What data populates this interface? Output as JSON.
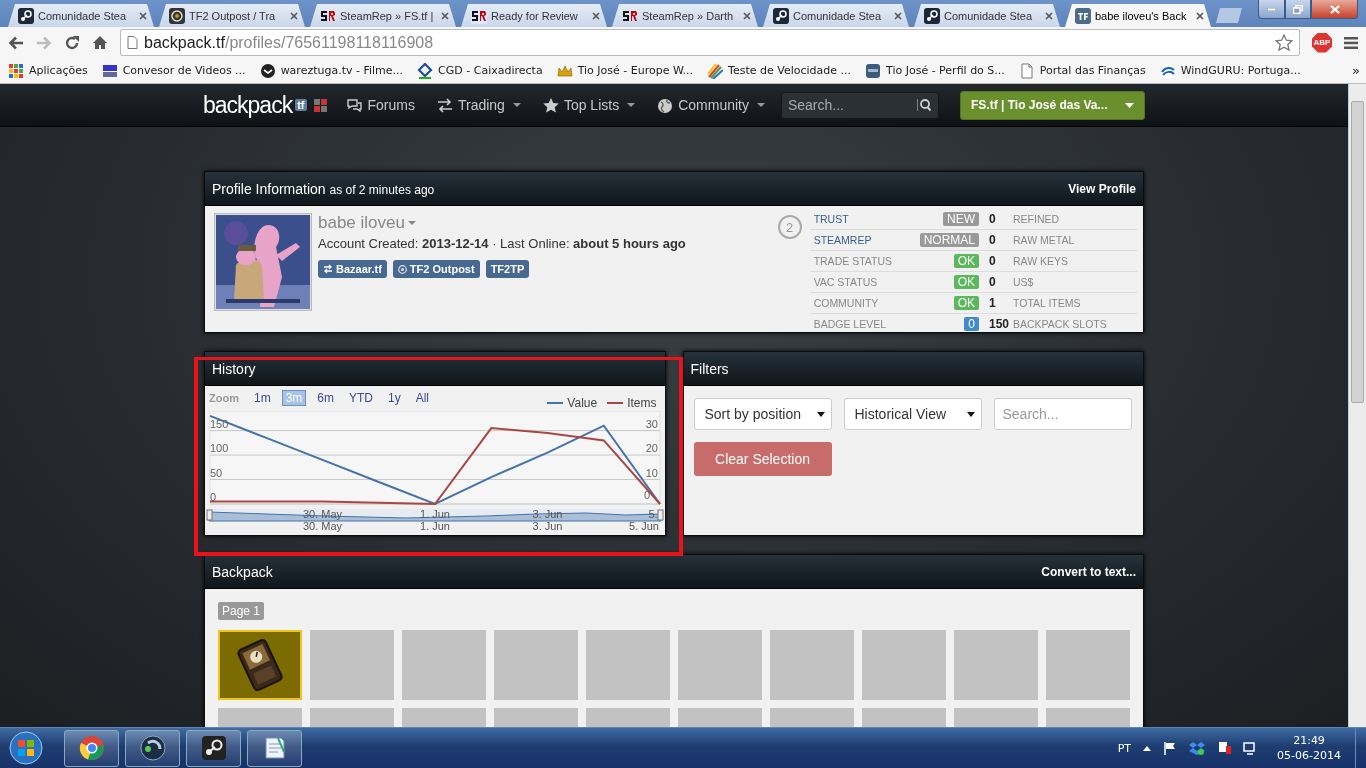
{
  "browser": {
    "tabs": [
      {
        "kind": "steam",
        "title": "Comunidade Stea",
        "selected": false
      },
      {
        "kind": "outpost",
        "title": "TF2 Outpost / Tra",
        "selected": false
      },
      {
        "kind": "sr",
        "title": "SteamRep » FS.tf |",
        "selected": false
      },
      {
        "kind": "sr-framed",
        "title": "Ready for Review",
        "selected": false
      },
      {
        "kind": "sr",
        "title": "SteamRep » Darth",
        "selected": false
      },
      {
        "kind": "steam",
        "title": "Comunidade Stea",
        "selected": false
      },
      {
        "kind": "steam",
        "title": "Comunidade Stea",
        "selected": false
      },
      {
        "kind": "tf",
        "title": "babe iloveu's Back",
        "selected": true
      }
    ],
    "address": {
      "domain": "backpack.tf",
      "path": "/profiles/76561198118116908"
    },
    "extension": "ABP",
    "bookmarks": [
      {
        "kind": "apps",
        "label": "Aplicações"
      },
      {
        "kind": "video",
        "label": "Convesor de Videos ..."
      },
      {
        "kind": "dark",
        "label": "wareztuga.tv - Filme..."
      },
      {
        "kind": "bank",
        "label": "CGD - Caixadirecta"
      },
      {
        "kind": "crown",
        "label": "Tio José - Europe W..."
      },
      {
        "kind": "rainbow",
        "label": "Teste de Velocidade ..."
      },
      {
        "kind": "square",
        "label": "Tio José - Perfil do S..."
      },
      {
        "kind": "page",
        "label": "Portal das Finanças"
      },
      {
        "kind": "wave",
        "label": "WindGURU: Portuga..."
      }
    ],
    "more": "»"
  },
  "nav": {
    "logo": "backpack",
    "logo_badge": "tf",
    "links": [
      {
        "kind": "forums",
        "label": "Forums",
        "dropdown": false
      },
      {
        "kind": "trading",
        "label": "Trading",
        "dropdown": true
      },
      {
        "kind": "star",
        "label": "Top Lists",
        "dropdown": true
      },
      {
        "kind": "globe",
        "label": "Community",
        "dropdown": true
      }
    ],
    "search": {
      "placeholder": "Search..."
    },
    "user": "FS.tf | Tio José das Va..."
  },
  "profile": {
    "title": "Profile Information",
    "subtitle": "as of 2 minutes ago",
    "action": "View Profile",
    "name": "babe iloveu",
    "info": "Account Created: **2013-12-14** · Last Online: **about 5 hours ago**",
    "buttons": [
      {
        "kind": "bazaar",
        "label": "Bazaar.tf"
      },
      {
        "kind": "outpost",
        "label": "TF2 Outpost"
      },
      {
        "kind": "plain",
        "label": "TF2TP"
      }
    ],
    "count": "2",
    "status": [
      {
        "label": "TRUST",
        "link": true,
        "badge": "NEW",
        "color": "#999999"
      },
      {
        "label": "STEAMREP",
        "link": true,
        "badge": "NORMAL",
        "color": "#999999"
      },
      {
        "label": "TRADE STATUS",
        "link": false,
        "badge": "OK",
        "color": "#5cb85c"
      },
      {
        "label": "VAC STATUS",
        "link": false,
        "badge": "OK",
        "color": "#5cb85c"
      },
      {
        "label": "COMMUNITY",
        "link": false,
        "badge": "OK",
        "color": "#5cb85c"
      },
      {
        "label": "BADGE LEVEL",
        "link": false,
        "badge": "0",
        "color": "#428bca"
      }
    ],
    "totals": [
      {
        "value": "0",
        "label": "REFINED"
      },
      {
        "value": "0",
        "label": "RAW METAL"
      },
      {
        "value": "0",
        "label": "RAW KEYS"
      },
      {
        "value": "0",
        "label": "US$"
      },
      {
        "value": "1",
        "label": "TOTAL ITEMS"
      },
      {
        "value": "150",
        "label": "BACKPACK SLOTS"
      }
    ]
  },
  "history": {
    "title": "History",
    "zoom_label": "Zoom",
    "ranges": [
      {
        "label": "1m",
        "selected": false
      },
      {
        "label": "3m",
        "selected": true
      },
      {
        "label": "6m",
        "selected": false
      },
      {
        "label": "YTD",
        "selected": false
      },
      {
        "label": "1y",
        "selected": false
      },
      {
        "label": "All",
        "selected": false
      }
    ],
    "chart_data": {
      "type": "line",
      "categories": [
        null,
        null,
        "30. May",
        null,
        "1. Jun",
        null,
        "3. Jun",
        null,
        "5."
      ],
      "series": [
        {
          "name": "Value",
          "color": "#4572a7",
          "values": [
            180,
            135,
            90,
            45,
            0,
            55,
            105,
            160,
            0
          ]
        },
        {
          "name": "Items",
          "color": "#aa4643",
          "values": [
            1,
            1,
            1,
            0.5,
            0,
            31,
            29,
            26,
            0
          ],
          "axis": "y2"
        }
      ],
      "ylim": [
        0,
        190
      ],
      "y2lim": [
        0,
        38
      ],
      "grid": true,
      "legend": "top right",
      "yticks": [
        0,
        50,
        100,
        150
      ],
      "y2ticks": [
        0,
        10,
        20,
        30
      ]
    },
    "navigator_labels": [
      "30. May",
      "1. Jun",
      "3. Jun",
      "5. Jun"
    ]
  },
  "filters": {
    "title": "Filters",
    "selects": [
      {
        "value": "Sort by position"
      },
      {
        "value": "Historical View"
      }
    ],
    "search": {
      "placeholder": "Search..."
    },
    "button": "Clear Selection"
  },
  "backpack": {
    "title": "Backpack",
    "action": "Convert to text...",
    "page": "Page 1",
    "slots": [
      {
        "filled": true,
        "selected": true
      },
      {
        "filled": false,
        "selected": false
      },
      {
        "filled": false,
        "selected": false
      },
      {
        "filled": false,
        "selected": false
      },
      {
        "filled": false,
        "selected": false
      },
      {
        "filled": false,
        "selected": false
      },
      {
        "filled": false,
        "selected": false
      },
      {
        "filled": false,
        "selected": false
      },
      {
        "filled": false,
        "selected": false
      },
      {
        "filled": false,
        "selected": false
      },
      {
        "filled": false,
        "selected": false
      },
      {
        "filled": false,
        "selected": false
      },
      {
        "filled": false,
        "selected": false
      },
      {
        "filled": false,
        "selected": false
      },
      {
        "filled": false,
        "selected": false
      },
      {
        "filled": false,
        "selected": false
      },
      {
        "filled": false,
        "selected": false
      },
      {
        "filled": false,
        "selected": false
      },
      {
        "filled": false,
        "selected": false
      },
      {
        "filled": false,
        "selected": false
      }
    ]
  },
  "highlight": {
    "kind": "rectangle"
  },
  "taskbar": {
    "apps": [
      {
        "kind": "chrome"
      },
      {
        "kind": "speaker"
      },
      {
        "kind": "steam"
      },
      {
        "kind": "notepad"
      }
    ],
    "language": "PT",
    "time": "21:49",
    "date": "05-06-2014"
  }
}
